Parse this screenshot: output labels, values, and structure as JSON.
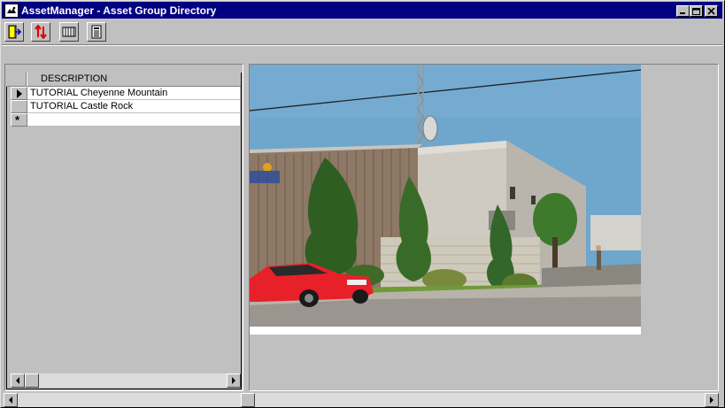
{
  "window": {
    "title": "AssetManager - Asset Group Directory",
    "controls": [
      "minimize",
      "maximize",
      "close"
    ]
  },
  "toolbar": {
    "buttons": [
      {
        "name": "exit-door-icon"
      },
      {
        "name": "sort-arrows-icon"
      },
      {
        "name": "columns-grid-icon"
      },
      {
        "name": "calculator-icon"
      }
    ]
  },
  "grid": {
    "columns": [
      "DESCRIPTION"
    ],
    "rows": [
      {
        "description": "TUTORIAL Cheyenne Mountain",
        "current": true
      },
      {
        "description": "TUTORIAL Castle Rock",
        "current": false
      }
    ],
    "new_row_marker": "*"
  },
  "image": {
    "caption_hidden": true
  },
  "colors": {
    "titlebar": "#000080",
    "face": "#c0c0c0",
    "grid_bg": "#ffffff",
    "sky": "#6fa6cc",
    "building": "#c8c4b8",
    "car": "#e8202a"
  }
}
